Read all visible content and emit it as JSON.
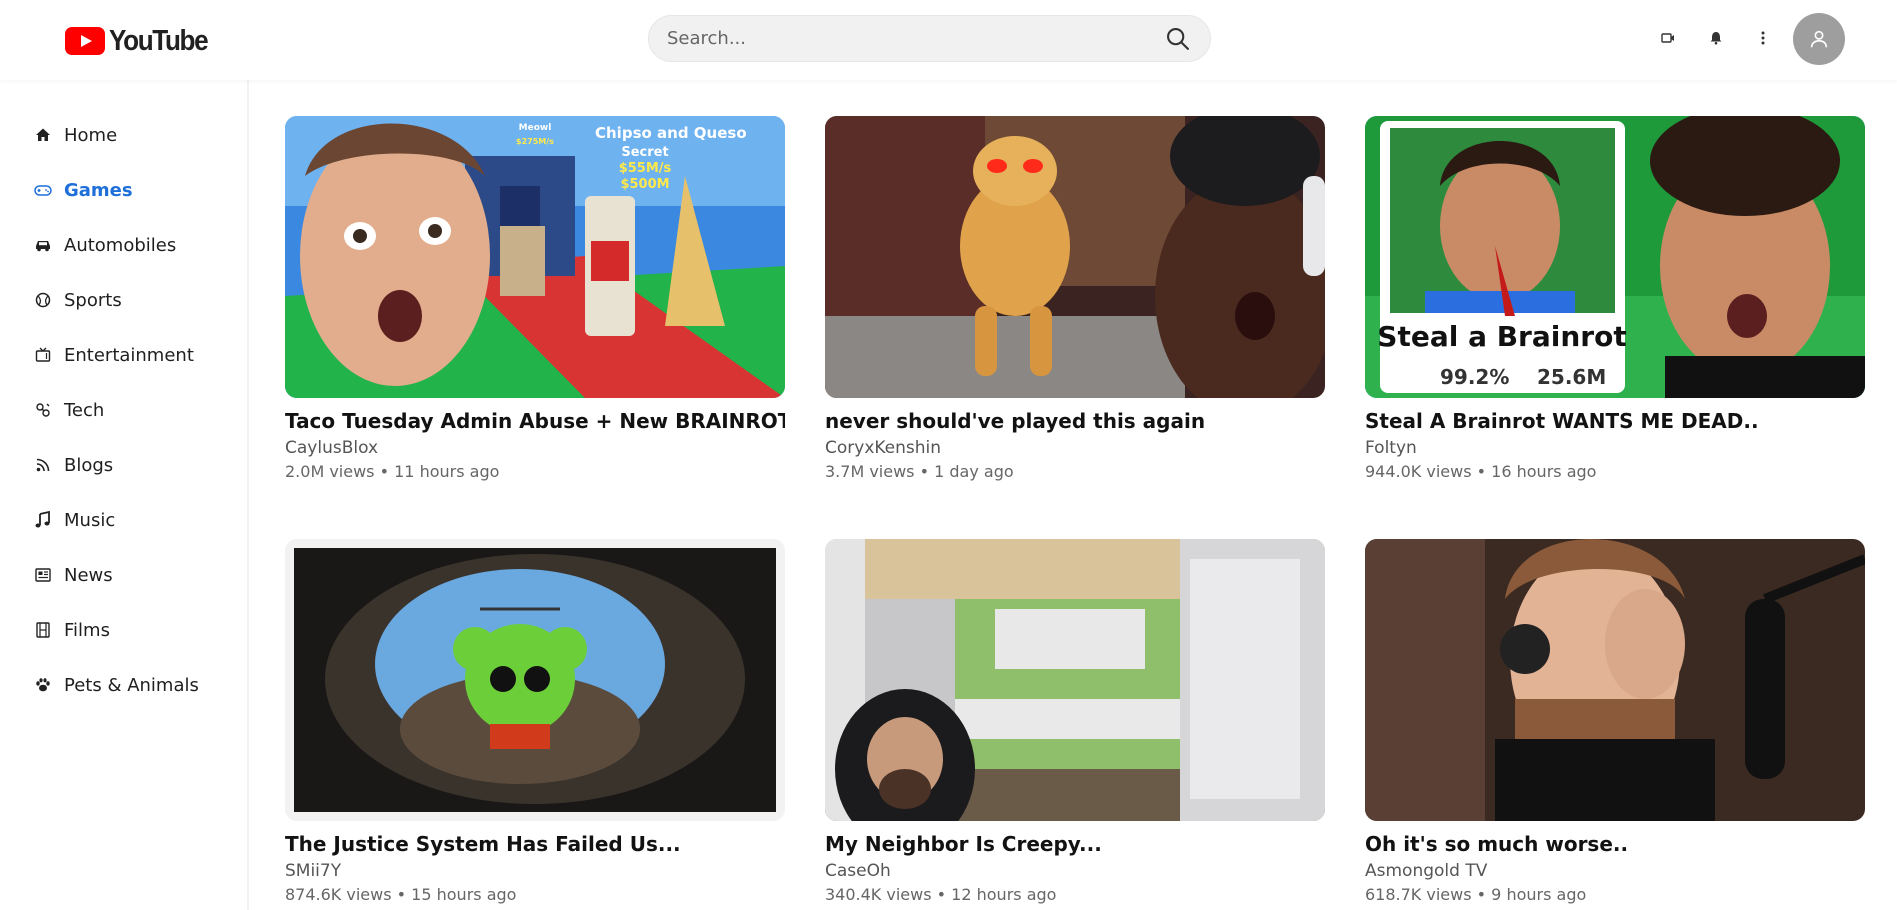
{
  "header": {
    "logo_text": "YouTube",
    "search_placeholder": "Search...",
    "icons": [
      "create-icon",
      "notifications-icon",
      "more-icon",
      "avatar-icon"
    ]
  },
  "sidebar": {
    "items": [
      {
        "label": "Home",
        "icon": "home-icon"
      },
      {
        "label": "Games",
        "icon": "gamepad-icon",
        "active": true
      },
      {
        "label": "Automobiles",
        "icon": "car-icon"
      },
      {
        "label": "Sports",
        "icon": "ball-icon"
      },
      {
        "label": "Entertainment",
        "icon": "tv-icon"
      },
      {
        "label": "Tech",
        "icon": "tech-icon"
      },
      {
        "label": "Blogs",
        "icon": "rss-icon"
      },
      {
        "label": "Music",
        "icon": "music-icon"
      },
      {
        "label": "News",
        "icon": "news-icon"
      },
      {
        "label": "Films",
        "icon": "film-icon"
      },
      {
        "label": "Pets & Animals",
        "icon": "paw-icon"
      }
    ]
  },
  "videos": [
    {
      "title": "Taco Tuesday Admin Abuse + New BRAINROTS!",
      "channel": "CaylusBlox",
      "meta": "2.0M views • 11 hours ago",
      "thumb_text": [
        "Chipso and Queso",
        "Secret",
        "$55M/s",
        "$500M",
        "Meowl",
        "$275M/s"
      ]
    },
    {
      "title": "never should've played this again",
      "channel": "CoryxKenshin",
      "meta": "3.7M views • 1 day ago"
    },
    {
      "title": "Steal A Brainrot WANTS ME DEAD..",
      "channel": "Foltyn",
      "meta": "944.0K views • 16 hours ago",
      "thumb_text": [
        "Steal a Brainrot",
        "99.2%",
        "25.6M"
      ]
    },
    {
      "title": "The Justice System Has Failed Us...",
      "channel": "SMii7Y",
      "meta": "874.6K views • 15 hours ago"
    },
    {
      "title": "My Neighbor Is Creepy...",
      "channel": "CaseOh",
      "meta": "340.4K views • 12 hours ago"
    },
    {
      "title": "Oh it's so much worse..",
      "channel": "Asmongold TV",
      "meta": "618.7K views • 9 hours ago"
    }
  ],
  "colors": {
    "accent": "#1e6fd9",
    "brand": "#ff0000"
  }
}
